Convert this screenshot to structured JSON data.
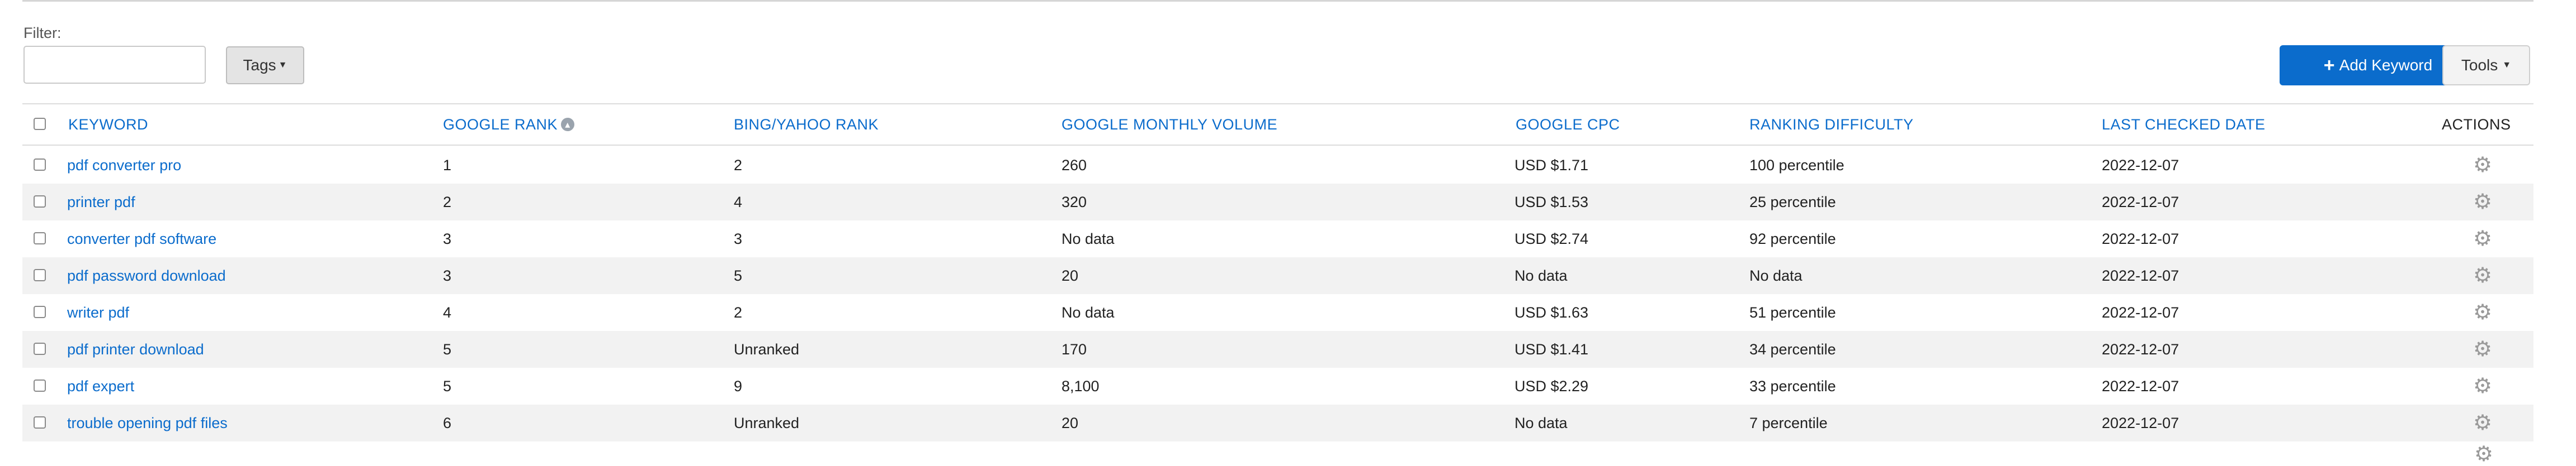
{
  "filter": {
    "label": "Filter:",
    "value": "",
    "placeholder": ""
  },
  "toolbar": {
    "tags_label": "Tags",
    "add_label": "Add Keyword",
    "tools_label": "Tools"
  },
  "table": {
    "columns": [
      "KEYWORD",
      "GOOGLE RANK",
      "BING/YAHOO RANK",
      "GOOGLE MONTHLY VOLUME",
      "GOOGLE CPC",
      "RANKING DIFFICULTY",
      "LAST CHECKED DATE",
      "ACTIONS"
    ],
    "rows": [
      {
        "keyword": "pdf converter pro",
        "google_rank": "1",
        "bing_rank": "2",
        "volume": "260",
        "cpc": "USD $1.71",
        "difficulty": "100 percentile",
        "date": "2022-12-07"
      },
      {
        "keyword": "printer pdf",
        "google_rank": "2",
        "bing_rank": "4",
        "volume": "320",
        "cpc": "USD $1.53",
        "difficulty": "25 percentile",
        "date": "2022-12-07"
      },
      {
        "keyword": "converter pdf software",
        "google_rank": "3",
        "bing_rank": "3",
        "volume": "No data",
        "cpc": "USD $2.74",
        "difficulty": "92 percentile",
        "date": "2022-12-07"
      },
      {
        "keyword": "pdf password download",
        "google_rank": "3",
        "bing_rank": "5",
        "volume": "20",
        "cpc": "No data",
        "difficulty": "No data",
        "date": "2022-12-07"
      },
      {
        "keyword": "writer pdf",
        "google_rank": "4",
        "bing_rank": "2",
        "volume": "No data",
        "cpc": "USD $1.63",
        "difficulty": "51 percentile",
        "date": "2022-12-07"
      },
      {
        "keyword": "pdf printer download",
        "google_rank": "5",
        "bing_rank": "Unranked",
        "volume": "170",
        "cpc": "USD $1.41",
        "difficulty": "34 percentile",
        "date": "2022-12-07"
      },
      {
        "keyword": "pdf expert",
        "google_rank": "5",
        "bing_rank": "9",
        "volume": "8,100",
        "cpc": "USD $2.29",
        "difficulty": "33 percentile",
        "date": "2022-12-07"
      },
      {
        "keyword": "trouble opening pdf files",
        "google_rank": "6",
        "bing_rank": "Unranked",
        "volume": "20",
        "cpc": "No data",
        "difficulty": "7 percentile",
        "date": "2022-12-07"
      }
    ]
  },
  "icons": {
    "plus": "plus-icon",
    "caret": "caret-down-icon",
    "gear": "gear-icon",
    "sort": "sort-icon"
  },
  "colors": {
    "link": "#0b6ccc",
    "primary_button": "#0b6ccc",
    "row_alt": "#f2f2f2"
  }
}
